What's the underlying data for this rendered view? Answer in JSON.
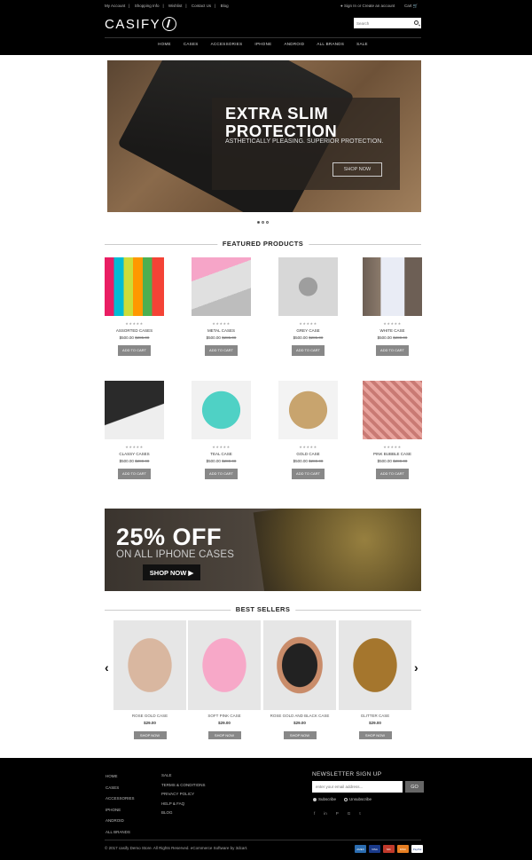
{
  "topbar": {
    "links": [
      "My Account",
      "Shopping Info",
      "Wishlist",
      "Contact Us",
      "Blog"
    ],
    "account": "Sign In or Create an account",
    "cart": "Cart"
  },
  "logo": "CASIFY",
  "search": {
    "placeholder": "Search"
  },
  "nav": [
    "HOME",
    "CASES",
    "ACCESSORIES",
    "IPHONE",
    "ANDROID",
    "ALL BRANDS",
    "SALE"
  ],
  "hero": {
    "title_line1": "EXTRA SLIM",
    "title_line2": "PROTECTION",
    "subtitle": "ASTHETICALLY PLEASING. SUPERIOR PROTECTION.",
    "button": "SHOP NOW"
  },
  "featured": {
    "heading": "FEATURED PRODUCTS",
    "stars": "★★★★★",
    "add_label": "ADD TO CART",
    "products": [
      {
        "name": "ASSORTED CASES",
        "price": "$500.00",
        "old": "$285.00",
        "rating": 0
      },
      {
        "name": "METAL CASES",
        "price": "$500.00",
        "old": "$285.00",
        "rating": 0
      },
      {
        "name": "GREY CASE",
        "price": "$500.00",
        "old": "$285.00",
        "rating": 0
      },
      {
        "name": "WHITE CASE",
        "price": "$500.00",
        "old": "$280.00",
        "rating": 0
      },
      {
        "name": "CLASSY CASES",
        "price": "$500.00",
        "old": "$280.00",
        "rating": 0
      },
      {
        "name": "TEAL CASE",
        "price": "$500.00",
        "old": "$280.00",
        "rating": 0
      },
      {
        "name": "GOLD CASE",
        "price": "$500.00",
        "old": "$280.00",
        "rating": 0
      },
      {
        "name": "PINK BUBBLE CASE",
        "price": "$500.00",
        "old": "$280.00",
        "rating": 0
      }
    ]
  },
  "promo": {
    "big": "25% OFF",
    "small": "ON ALL IPHONE CASES",
    "button": "SHOP NOW"
  },
  "bestsellers": {
    "heading": "BEST SELLERS",
    "shop_label": "SHOP NOW",
    "items": [
      {
        "name": "ROSE GOLD CASE",
        "price": "$29.00"
      },
      {
        "name": "SOFT PINK CASE",
        "price": "$29.00"
      },
      {
        "name": "ROSE GOLD AND BLACK CASE",
        "price": "$29.00"
      },
      {
        "name": "GLITTER CASE",
        "price": "$29.00"
      }
    ]
  },
  "footer": {
    "col1": [
      "HOME",
      "CASES",
      "ACCESSORIES",
      "IPHONE",
      "ANDROID",
      "ALL BRANDS"
    ],
    "col2": [
      "SALE",
      "TERMS & CONDITIONS",
      "PRIVACY POLICY",
      "HELP & FAQ",
      "BLOG"
    ],
    "newsletter_title": "NEWSLETTER SIGN UP",
    "email_placeholder": "enter your email address...",
    "go": "GO",
    "subscribe": "Subscribe",
    "unsubscribe": "Unsubscribe",
    "social": [
      "f",
      "in",
      "P",
      "G",
      "t"
    ],
    "copyright": "© 2017 casify Demo Store. All Rights Reserved. eCommerce Software by 3dcart.",
    "payments": [
      "AMEX",
      "VISA",
      "MC",
      "DISC",
      "PayPal"
    ]
  },
  "colors": {
    "topbar": "#000000",
    "button_gray": "#888888",
    "footer": "#000000"
  }
}
